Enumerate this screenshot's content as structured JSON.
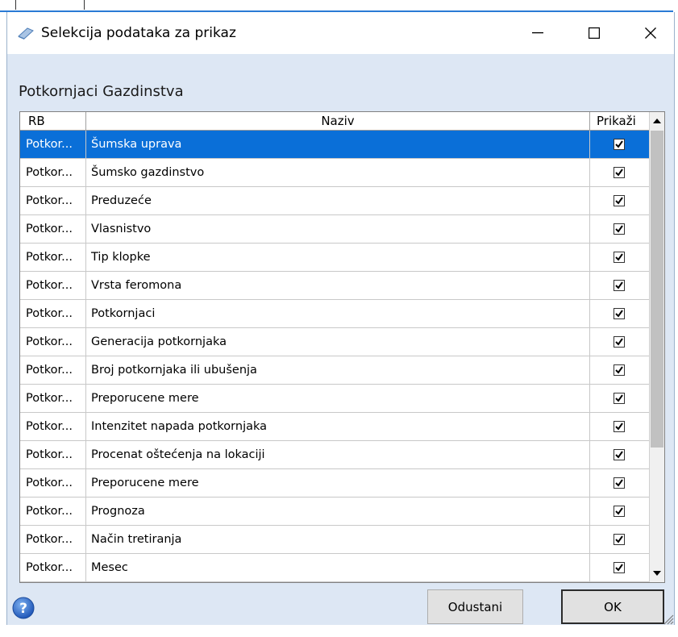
{
  "window": {
    "title": "Selekcija podataka za prikaz",
    "group_label": "Potkornjaci Gazdinstva"
  },
  "grid": {
    "headers": {
      "rb": "RB",
      "naziv": "Naziv",
      "prikazi": "Prikaži"
    },
    "rows": [
      {
        "rb": "Potkor...",
        "naziv": "Šumska uprava",
        "checked": true,
        "selected": true
      },
      {
        "rb": "Potkor...",
        "naziv": "Šumsko gazdinstvo",
        "checked": true
      },
      {
        "rb": "Potkor...",
        "naziv": "Preduzeće",
        "checked": true
      },
      {
        "rb": "Potkor...",
        "naziv": "Vlasnistvo",
        "checked": true
      },
      {
        "rb": "Potkor...",
        "naziv": "Tip klopke",
        "checked": true
      },
      {
        "rb": "Potkor...",
        "naziv": "Vrsta feromona",
        "checked": true
      },
      {
        "rb": "Potkor...",
        "naziv": "Potkornjaci",
        "checked": true
      },
      {
        "rb": "Potkor...",
        "naziv": "Generacija potkornjaka",
        "checked": true
      },
      {
        "rb": "Potkor...",
        "naziv": "Broj potkornjaka ili ubušenja",
        "checked": true
      },
      {
        "rb": "Potkor...",
        "naziv": "Preporucene mere",
        "checked": true
      },
      {
        "rb": "Potkor...",
        "naziv": "Intenzitet napada potkornjaka",
        "checked": true
      },
      {
        "rb": "Potkor...",
        "naziv": "Procenat oštećenja na lokaciji",
        "checked": true
      },
      {
        "rb": "Potkor...",
        "naziv": "Preporucene mere",
        "checked": true
      },
      {
        "rb": "Potkor...",
        "naziv": "Prognoza",
        "checked": true
      },
      {
        "rb": "Potkor...",
        "naziv": "Način tretiranja",
        "checked": true
      },
      {
        "rb": "Potkor...",
        "naziv": "Mesec",
        "checked": true
      }
    ]
  },
  "buttons": {
    "cancel": "Odustani",
    "ok": "OK"
  },
  "colors": {
    "selection": "#0a6fd8",
    "dialog_bg": "#dde7f4",
    "accent_line": "#2a7ad5"
  }
}
